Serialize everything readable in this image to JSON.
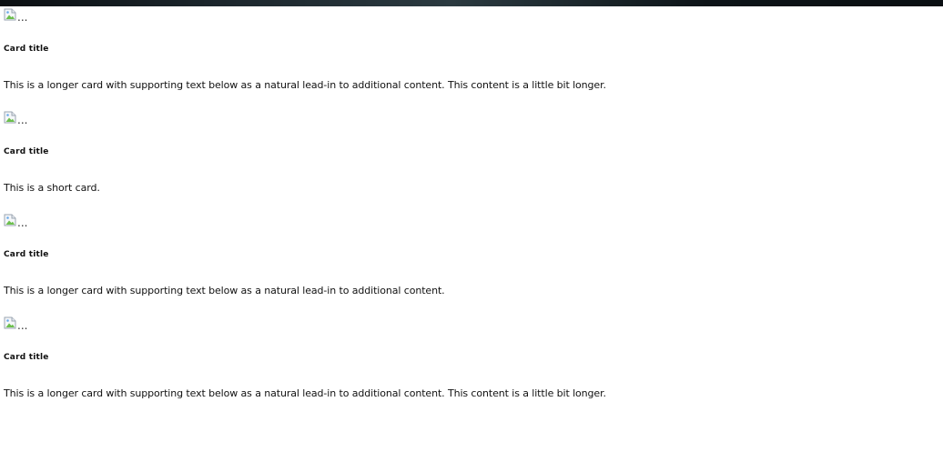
{
  "cards": [
    {
      "image_alt": "...",
      "title": "Card title",
      "text": "This is a longer card with supporting text below as a natural lead-in to additional content. This content is a little bit longer."
    },
    {
      "image_alt": "...",
      "title": "Card title",
      "text": "This is a short card."
    },
    {
      "image_alt": "...",
      "title": "Card title",
      "text": "This is a longer card with supporting text below as a natural lead-in to additional content."
    },
    {
      "image_alt": "...",
      "title": "Card title",
      "text": "This is a longer card with supporting text below as a natural lead-in to additional content. This content is a little bit longer."
    }
  ],
  "icons": {
    "broken_image": "broken-image-icon"
  }
}
